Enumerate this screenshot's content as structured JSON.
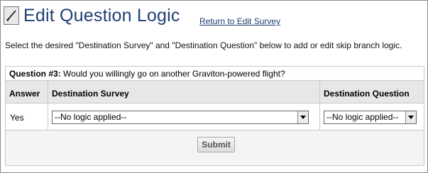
{
  "header": {
    "title": "Edit Question Logic",
    "return_link": "Return to Edit Survey",
    "icon": "pencil-icon"
  },
  "instructions": "Select the desired \"Destination Survey\" and \"Destination Question\" below to add or edit skip branch logic.",
  "question": {
    "label": "Question #3:",
    "text": "Would you willingly go on another Graviton-powered flight?"
  },
  "table": {
    "columns": [
      "Answer",
      "Destination Survey",
      "Destination Question"
    ],
    "rows": [
      {
        "answer": "Yes",
        "destination_survey": "--No logic applied--",
        "destination_question": "--No logic applied--"
      }
    ]
  },
  "submit_label": "Submit"
}
